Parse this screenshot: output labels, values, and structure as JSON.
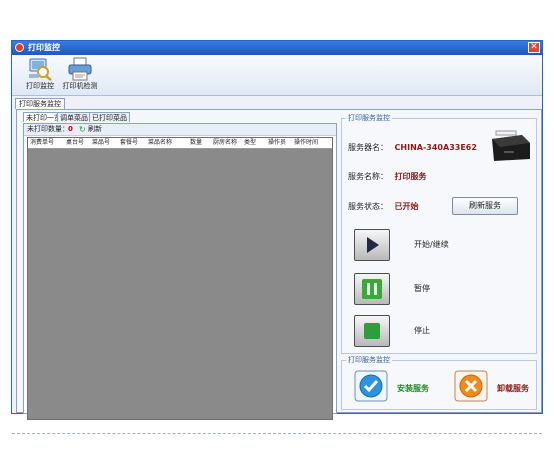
{
  "window": {
    "title": "打印监控",
    "accent": "#2b63c2"
  },
  "toolbar": {
    "print_monitor": "打印监控",
    "printer_check": "打印机检测"
  },
  "tabs": {
    "main": "打印服务监控"
  },
  "subtabs": [
    "未打印一览",
    "调单菜品",
    "已打印菜品"
  ],
  "list": {
    "unprinted_label": "未打印数量：",
    "unprinted_count": "0",
    "refresh": "刷新"
  },
  "grid": {
    "columns": [
      "消费单号",
      "桌台号",
      "菜品号",
      "套餐号",
      "菜品名称",
      "数量",
      "厨房名称",
      "类型",
      "操作员",
      "操作时间"
    ]
  },
  "service": {
    "group_title": "打印服务监控",
    "name_label": "服务器名：",
    "name_value": "CHINA-340A33E62",
    "svc_label": "服务名称：",
    "svc_value": "打印服务",
    "status_label": "服务状态：",
    "status_value": "已开始",
    "refresh_btn": "刷新服务",
    "start": "开始/继续",
    "pause": "暂停",
    "stop": "停止"
  },
  "install": {
    "group_title": "打印服务监控",
    "install": "安装服务",
    "uninstall": "卸载服务"
  }
}
